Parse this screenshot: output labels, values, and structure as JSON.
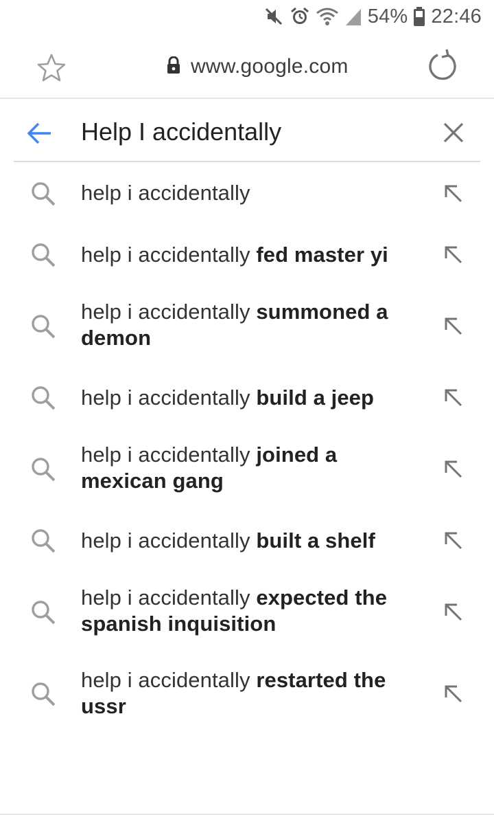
{
  "status_bar": {
    "battery_percent": "54%",
    "time": "22:46",
    "icons": [
      "mute-icon",
      "alarm-icon",
      "wifi-icon",
      "signal-icon",
      "battery-icon"
    ]
  },
  "address_bar": {
    "url": "www.google.com",
    "icons": [
      "star-icon",
      "lock-icon",
      "reload-icon"
    ]
  },
  "search": {
    "value": "Help I accidentally"
  },
  "suggestions": [
    {
      "prefix": "help i accidentally",
      "completion": ""
    },
    {
      "prefix": "help i accidentally ",
      "completion": "fed master yi"
    },
    {
      "prefix": "help i accidentally ",
      "completion": "summoned a demon"
    },
    {
      "prefix": "help i accidentally ",
      "completion": "build a jeep"
    },
    {
      "prefix": "help i accidentally ",
      "completion": "joined a mexican gang"
    },
    {
      "prefix": "help i accidentally ",
      "completion": "built a shelf"
    },
    {
      "prefix": "help i accidentally ",
      "completion": "expected the spanish inquisition"
    },
    {
      "prefix": "help i accidentally ",
      "completion": "restarted the ussr"
    }
  ],
  "colors": {
    "accent": "#4285f4",
    "icon_gray": "#9e9e9e",
    "text": "#333333"
  }
}
